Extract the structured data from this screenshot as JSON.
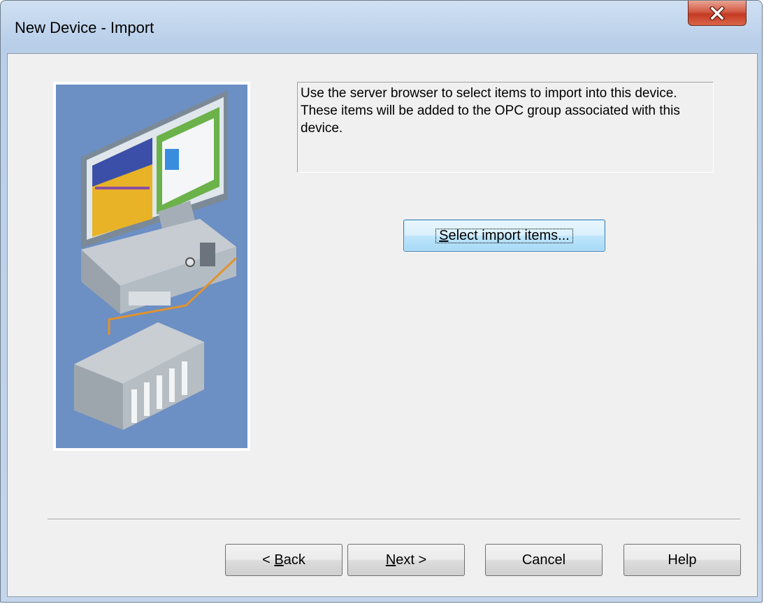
{
  "window": {
    "title": "New Device - Import",
    "close_icon": "close-x-icon"
  },
  "illustration": {
    "description_icon": "computer-and-plc-illustration"
  },
  "description": {
    "text": "Use the server browser to select items to import into this device. These items will be added to the OPC group associated with this device."
  },
  "select_button": {
    "accel": "S",
    "rest": "elect import items..."
  },
  "footer": {
    "back": {
      "prefix": "< ",
      "accel": "B",
      "rest": "ack"
    },
    "next": {
      "accel": "N",
      "rest": "ext >"
    },
    "cancel": "Cancel",
    "help": "Help"
  },
  "colors": {
    "illustration_bg": "#6c8fc4",
    "close_button": "#c43a22",
    "dialog_bg": "#f0f0f0"
  }
}
